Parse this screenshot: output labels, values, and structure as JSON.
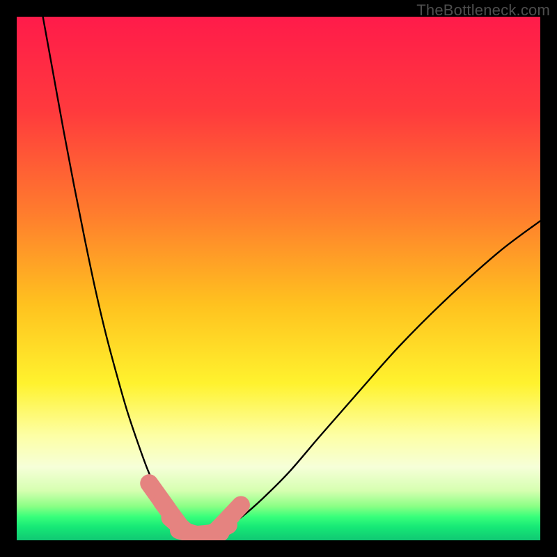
{
  "watermark": "TheBottleneck.com",
  "colors": {
    "frame": "#000000",
    "gradient_stops": [
      {
        "pos": 0.0,
        "color": "#ff1b4a"
      },
      {
        "pos": 0.18,
        "color": "#ff3a3d"
      },
      {
        "pos": 0.38,
        "color": "#ff7e2d"
      },
      {
        "pos": 0.55,
        "color": "#ffc21f"
      },
      {
        "pos": 0.7,
        "color": "#fff22e"
      },
      {
        "pos": 0.8,
        "color": "#fdffa5"
      },
      {
        "pos": 0.86,
        "color": "#f6ffd8"
      },
      {
        "pos": 0.905,
        "color": "#d6ffb1"
      },
      {
        "pos": 0.935,
        "color": "#8bff85"
      },
      {
        "pos": 0.955,
        "color": "#38ff7b"
      },
      {
        "pos": 0.975,
        "color": "#16e876"
      },
      {
        "pos": 1.0,
        "color": "#10c873"
      }
    ],
    "curve": "#000000",
    "marker_fill": "#e58380",
    "marker_stroke": "#d66a67"
  },
  "chart_data": {
    "type": "line",
    "title": "",
    "xlabel": "",
    "ylabel": "",
    "xlim": [
      0,
      100
    ],
    "ylim": [
      0,
      100
    ],
    "grid": false,
    "legend": false,
    "series": [
      {
        "name": "left-curve",
        "x": [
          5,
          7,
          9,
          11,
          13,
          15,
          17,
          19,
          21,
          23,
          25,
          27,
          29,
          30.5,
          32,
          33.5,
          35
        ],
        "y": [
          100,
          89,
          78,
          67.5,
          57.5,
          48,
          39.5,
          32,
          25,
          19,
          13.5,
          9,
          5.5,
          3.5,
          2.2,
          1.4,
          1.0
        ]
      },
      {
        "name": "right-curve",
        "x": [
          35,
          37,
          40,
          43,
          47,
          52,
          58,
          65,
          73,
          82,
          92,
          100
        ],
        "y": [
          1.0,
          1.3,
          2.5,
          4.5,
          8,
          13,
          20,
          28,
          37,
          46,
          55,
          61
        ]
      }
    ],
    "markers": {
      "name": "highlighted-points",
      "type": "scatter",
      "style": "rounded-segment",
      "x": [
        27.0,
        29.5,
        31.5,
        33.8,
        36.0,
        37.8,
        39.0,
        40.8
      ],
      "y": [
        8.5,
        5.0,
        2.4,
        1.2,
        1.2,
        1.6,
        2.7,
        4.6
      ]
    }
  }
}
